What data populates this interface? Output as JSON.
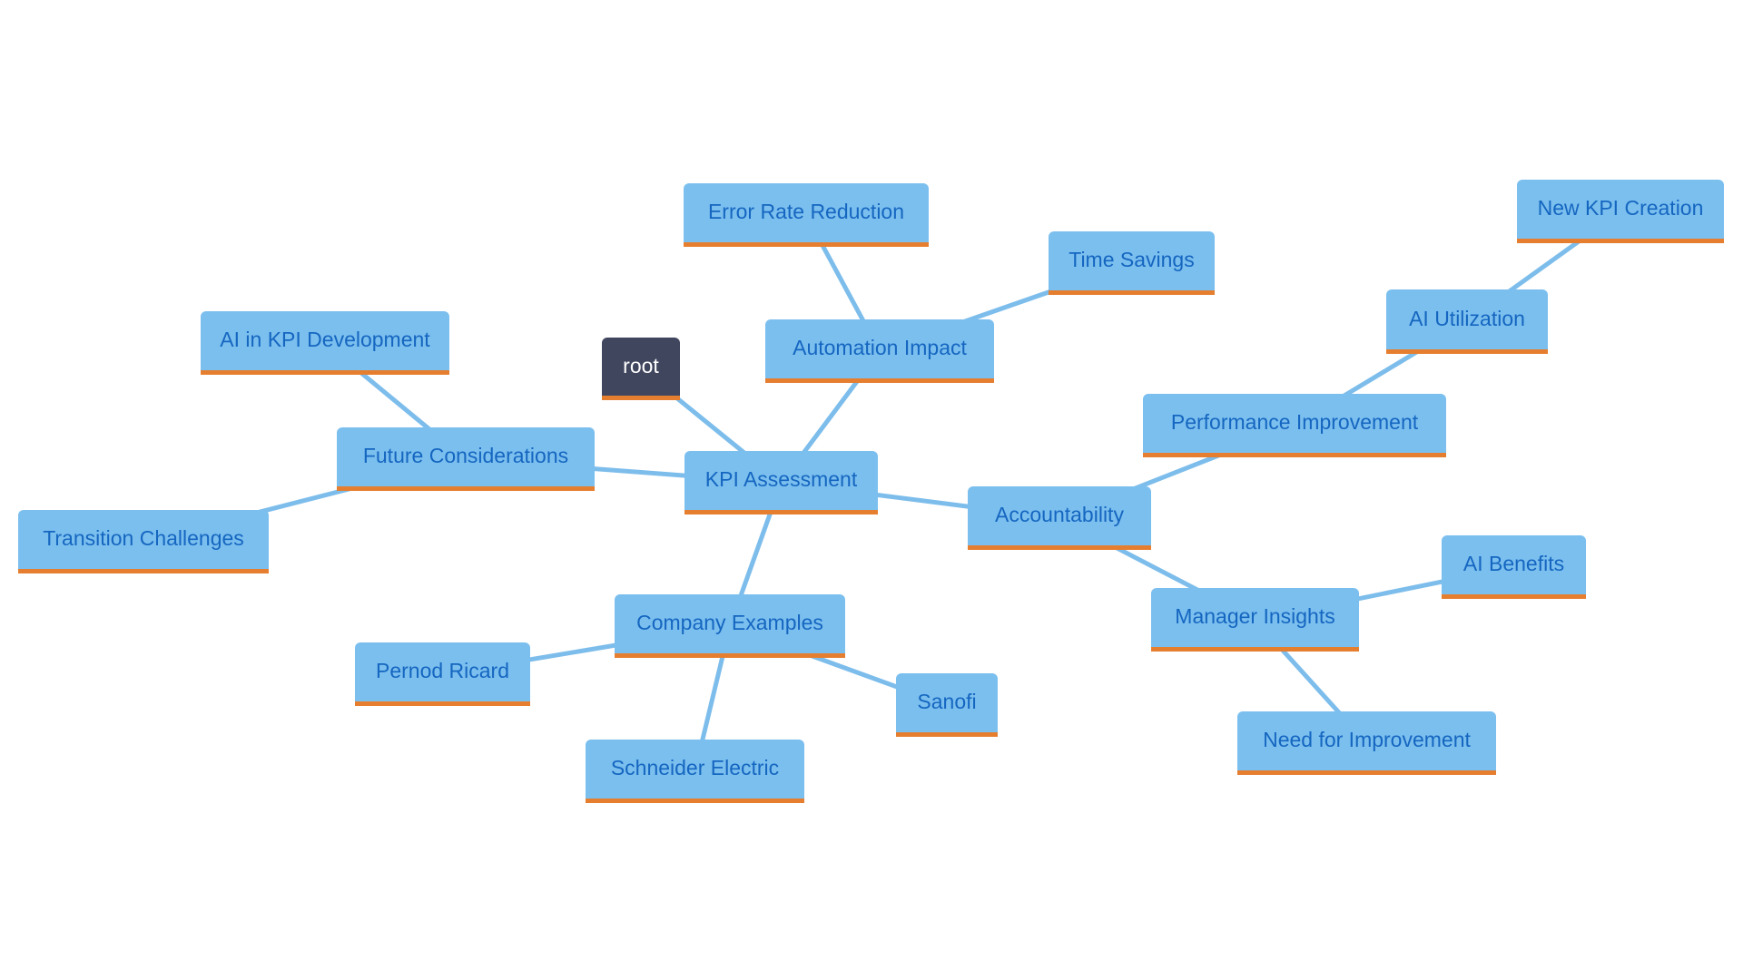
{
  "diagram": {
    "type": "mindmap",
    "colors": {
      "node_fill": "#7bbfef",
      "node_text": "#1566c0",
      "node_underline": "#e67e30",
      "root_fill": "#40465e",
      "root_text": "#ffffff",
      "edge": "#7dbdeb"
    },
    "nodes": [
      {
        "id": "root",
        "label": "root"
      },
      {
        "id": "kpi",
        "label": "KPI Assessment"
      },
      {
        "id": "auto",
        "label": "Automation Impact"
      },
      {
        "id": "err",
        "label": "Error Rate Reduction"
      },
      {
        "id": "time",
        "label": "Time Savings"
      },
      {
        "id": "future",
        "label": "Future Considerations"
      },
      {
        "id": "aikpi",
        "label": "AI in KPI Development"
      },
      {
        "id": "trans",
        "label": "Transition Challenges"
      },
      {
        "id": "acc",
        "label": "Accountability"
      },
      {
        "id": "perf",
        "label": "Performance Improvement"
      },
      {
        "id": "aiutil",
        "label": "AI Utilization"
      },
      {
        "id": "newkpi",
        "label": "New KPI Creation"
      },
      {
        "id": "mgr",
        "label": "Manager Insights"
      },
      {
        "id": "aiben",
        "label": "AI Benefits"
      },
      {
        "id": "need",
        "label": "Need for Improvement"
      },
      {
        "id": "comp",
        "label": "Company Examples"
      },
      {
        "id": "pernod",
        "label": "Pernod Ricard"
      },
      {
        "id": "sanofi",
        "label": "Sanofi"
      },
      {
        "id": "schneider",
        "label": "Schneider Electric"
      }
    ],
    "edges": [
      [
        "root",
        "kpi"
      ],
      [
        "kpi",
        "auto"
      ],
      [
        "auto",
        "err"
      ],
      [
        "auto",
        "time"
      ],
      [
        "kpi",
        "future"
      ],
      [
        "future",
        "aikpi"
      ],
      [
        "future",
        "trans"
      ],
      [
        "kpi",
        "acc"
      ],
      [
        "acc",
        "perf"
      ],
      [
        "perf",
        "aiutil"
      ],
      [
        "aiutil",
        "newkpi"
      ],
      [
        "acc",
        "mgr"
      ],
      [
        "mgr",
        "aiben"
      ],
      [
        "mgr",
        "need"
      ],
      [
        "kpi",
        "comp"
      ],
      [
        "comp",
        "pernod"
      ],
      [
        "comp",
        "sanofi"
      ],
      [
        "comp",
        "schneider"
      ]
    ]
  }
}
